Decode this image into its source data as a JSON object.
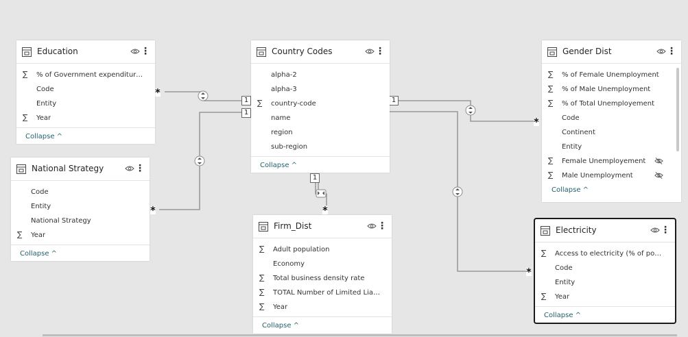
{
  "tables": {
    "education": {
      "title": "Education",
      "fields": [
        {
          "label": "% of Government expenditure o...",
          "sigma": "∑"
        },
        {
          "label": "Code",
          "sigma": ""
        },
        {
          "label": "Entity",
          "sigma": ""
        },
        {
          "label": "Year",
          "sigma": "∑"
        }
      ],
      "collapse": "Collapse ^"
    },
    "national_strategy": {
      "title": "National Strategy",
      "fields": [
        {
          "label": "Code",
          "sigma": ""
        },
        {
          "label": "Entity",
          "sigma": ""
        },
        {
          "label": "National Strategy",
          "sigma": ""
        },
        {
          "label": "Year",
          "sigma": "∑"
        }
      ],
      "collapse": "Collapse ^"
    },
    "country_codes": {
      "title": "Country Codes",
      "fields": [
        {
          "label": "alpha-2",
          "sigma": ""
        },
        {
          "label": "alpha-3",
          "sigma": ""
        },
        {
          "label": "country-code",
          "sigma": "∑"
        },
        {
          "label": "name",
          "sigma": ""
        },
        {
          "label": "region",
          "sigma": ""
        },
        {
          "label": "sub-region",
          "sigma": ""
        }
      ],
      "collapse": "Collapse ^"
    },
    "firm_dist": {
      "title": "Firm_Dist",
      "fields": [
        {
          "label": "Adult population",
          "sigma": "∑"
        },
        {
          "label": "Economy",
          "sigma": ""
        },
        {
          "label": "Total business density rate",
          "sigma": "∑"
        },
        {
          "label": "TOTAL Number of Limited Liabil...",
          "sigma": "∑"
        },
        {
          "label": "Year",
          "sigma": "∑"
        }
      ],
      "collapse": "Collapse ^"
    },
    "gender_dist": {
      "title": "Gender Dist",
      "fields": [
        {
          "label": "% of Female Unemployment",
          "sigma": "∑"
        },
        {
          "label": "% of Male Unemployment",
          "sigma": "∑"
        },
        {
          "label": "% of Total Unemployement",
          "sigma": "∑"
        },
        {
          "label": "Code",
          "sigma": ""
        },
        {
          "label": "Continent",
          "sigma": ""
        },
        {
          "label": "Entity",
          "sigma": ""
        },
        {
          "label": "Female Unemployement",
          "sigma": "∑",
          "hidden": true
        },
        {
          "label": "Male Unemployment",
          "sigma": "∑",
          "hidden": true
        }
      ],
      "collapse": "Collapse ^"
    },
    "electricity": {
      "title": "Electricity",
      "fields": [
        {
          "label": "Access to electricity (% of popul...",
          "sigma": "∑"
        },
        {
          "label": "Code",
          "sigma": ""
        },
        {
          "label": "Entity",
          "sigma": ""
        },
        {
          "label": "Year",
          "sigma": "∑"
        }
      ],
      "collapse": "Collapse ^"
    }
  },
  "cardinality": {
    "one": "1",
    "many": "*"
  },
  "colors": {
    "line": "#8a8a8a",
    "canvas": "#e6e6e6",
    "link": "#1f5f6b"
  },
  "icons": {
    "table": "table-icon",
    "visibility": "eye-icon",
    "more": "more-options-icon",
    "hidden": "eye-slash-icon"
  }
}
